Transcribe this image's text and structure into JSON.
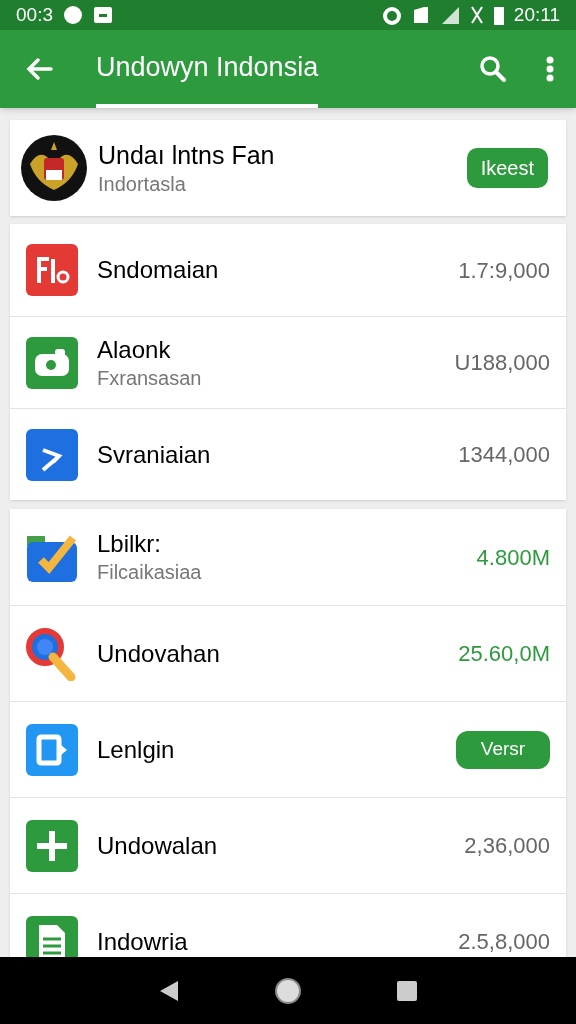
{
  "status_bar": {
    "left_time": "00:3",
    "right_time": "20:11"
  },
  "app_bar": {
    "title": "Undowyn Indonsia",
    "title_selected": true
  },
  "header_card": {
    "title": "Undaı lntns Fan",
    "subtitle": "Indortasla",
    "button": "Ikeest"
  },
  "groups": [
    {
      "rows": [
        {
          "title": "Sndomaian",
          "kind": "amount",
          "value": "1.7:9,000"
        },
        {
          "title": "Alaonk",
          "subtitle": "Fxransasan",
          "kind": "amount",
          "value": "U188,000"
        },
        {
          "title": "Svraniaian",
          "kind": "amount",
          "value": "1344,000"
        }
      ]
    },
    {
      "rows": [
        {
          "title": "Lbilkr:",
          "subtitle": "Filcaikasiaa",
          "kind": "growth",
          "value": "4.800M"
        },
        {
          "title": "Undovahan",
          "kind": "growth",
          "value": "25.60,0M"
        },
        {
          "title": "Lenlgin",
          "kind": "button",
          "value": "Versr"
        },
        {
          "title": "Undowalan",
          "kind": "amount",
          "value": "2,36,000"
        },
        {
          "title": "Indowria",
          "kind": "amount",
          "value": "2.5,8,000"
        }
      ]
    }
  ]
}
